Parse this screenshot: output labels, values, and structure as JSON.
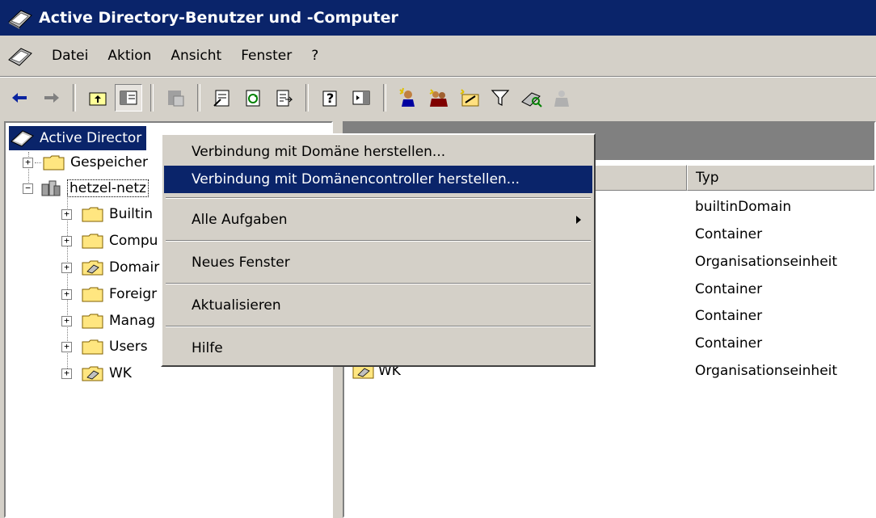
{
  "window": {
    "title": "Active Directory-Benutzer und -Computer"
  },
  "menubar": {
    "items": [
      "Datei",
      "Aktion",
      "Ansicht",
      "Fenster",
      "?"
    ]
  },
  "toolbar": {
    "icons": [
      "back-arrow-icon",
      "forward-arrow-icon",
      "up-folder-icon",
      "show-hide-tree-icon",
      "delete-icon",
      "properties-icon",
      "refresh-icon",
      "export-list-icon",
      "help-icon",
      "console-tree-icon",
      "new-user-icon",
      "new-group-icon",
      "new-ou-icon",
      "filter-icon",
      "find-icon",
      "add-to-group-icon"
    ]
  },
  "tree": {
    "root_label": "Active Director",
    "items": [
      {
        "label": "Gespeicher",
        "icon": "folder-icon",
        "level": 1
      },
      {
        "label": "hetzel-netz",
        "icon": "domain-icon",
        "level": 1
      },
      {
        "label": "Builtin",
        "icon": "folder-icon",
        "level": 2
      },
      {
        "label": "Compu",
        "icon": "folder-icon",
        "level": 2
      },
      {
        "label": "Domair",
        "icon": "ou-icon",
        "level": 2
      },
      {
        "label": "Foreigr",
        "icon": "folder-icon",
        "level": 2
      },
      {
        "label": "Manag",
        "icon": "folder-icon",
        "level": 2
      },
      {
        "label": "Users",
        "icon": "folder-icon",
        "level": 2
      },
      {
        "label": "WK",
        "icon": "ou-icon",
        "level": 2
      }
    ]
  },
  "list": {
    "type_header": "Typ",
    "types": [
      "builtinDomain",
      "Container",
      "Organisationseinheit",
      "Container",
      "Container",
      "Container",
      "Organisationseinheit"
    ],
    "last_name": "WK"
  },
  "context_menu": {
    "items": [
      {
        "label": "Verbindung mit Domäne herstellen..."
      },
      {
        "label": "Verbindung mit Domänencontroller herstellen..."
      },
      {
        "label": "Alle Aufgaben"
      },
      {
        "label": "Neues Fenster"
      },
      {
        "label": "Aktualisieren"
      },
      {
        "label": "Hilfe"
      }
    ]
  },
  "colors": {
    "title_bg": "#0a246a",
    "face": "#d4d0c8",
    "highlight": "#0a246a"
  }
}
